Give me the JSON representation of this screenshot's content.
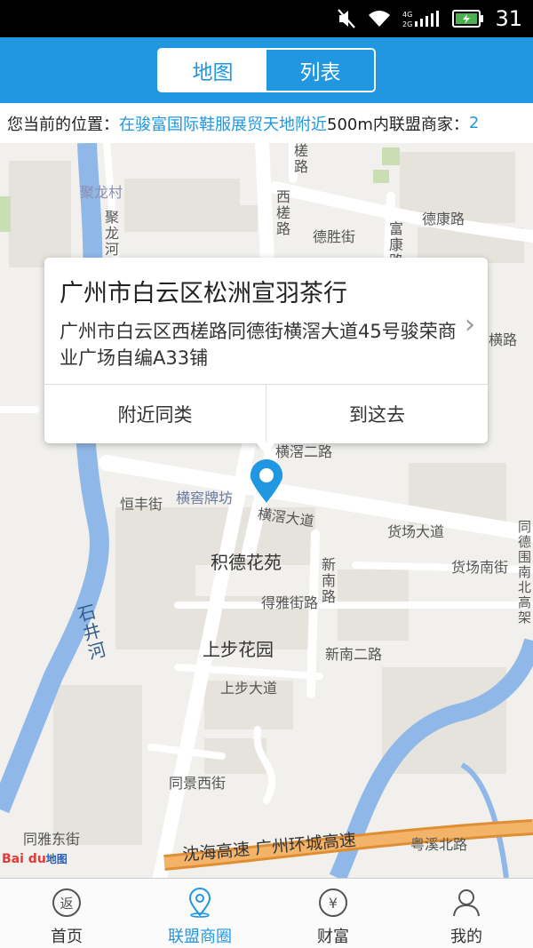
{
  "status_bar": {
    "network_label": "4G 2G",
    "battery_level": "31"
  },
  "header": {
    "tabs": [
      {
        "label": "地图",
        "active": true
      },
      {
        "label": "列表",
        "active": false
      }
    ]
  },
  "location_bar": {
    "prefix": "您当前的位置：",
    "place": "在骏富国际鞋服展贸天地附近",
    "middle": "500m内联盟商家：",
    "count": "2"
  },
  "map": {
    "labels": {
      "julongcun": "聚龙村",
      "julonghe": "聚龙河",
      "xiquelu": "西槎路",
      "lu_top": "槎路",
      "deshengjie": "德胜街",
      "dekanglu": "德康路",
      "fukanglu": "富康路",
      "henglu": "横路",
      "hengjiao_erlu": "横滘二路",
      "hengfengjie": "恒丰街",
      "hengjiao_paifang": "横窖牌坊",
      "hengjiao_dadao": "横滘大道",
      "huochang_dadao": "货场大道",
      "huochang_nanjie": "货场南街",
      "jide_huayuan": "积德花苑",
      "xinnanlu": "新南路",
      "deyajielu": "得雅街路",
      "shijinghe": "石井河",
      "shangbu_huayuan": "上步花园",
      "xinnan_erlu": "新南二路",
      "shangbu_dadao": "上步大道",
      "tongjing_xijie": "同景西街",
      "tongya_dongjie": "同雅东街",
      "highway": "沈海高速 广州环城高速",
      "yuexi_beilu": "粤溪北路",
      "tongde_north": "同德围南北高架"
    },
    "logo": {
      "brand": "Bai du",
      "suffix": "地图"
    }
  },
  "popup": {
    "title": "广州市白云区松洲宣羽茶行",
    "address": "广州市白云区西槎路同德街横滘大道45号骏荣商业广场自编A33铺",
    "nearby_button": "附近同类",
    "goto_button": "到这去"
  },
  "tabbar": {
    "items": [
      {
        "label": "首页",
        "icon": "return-icon",
        "active": false
      },
      {
        "label": "联盟商圈",
        "icon": "location-pin-icon",
        "active": true
      },
      {
        "label": "财富",
        "icon": "yen-icon",
        "active": false
      },
      {
        "label": "我的",
        "icon": "person-icon",
        "active": false
      }
    ]
  },
  "colors": {
    "accent": "#2197e2",
    "river": "#8fb8e8",
    "highway": "#f0a551"
  }
}
